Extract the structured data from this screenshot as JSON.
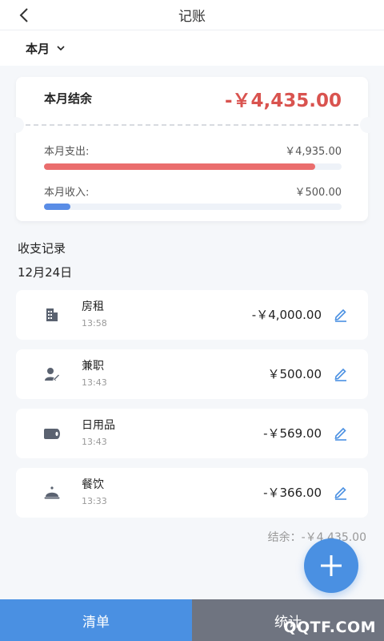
{
  "header": {
    "title": "记账",
    "back_icon": "chevron-left-icon"
  },
  "month_selector": {
    "label": "本月",
    "icon": "chevron-down-icon"
  },
  "summary": {
    "balance_label": "本月结余",
    "balance_value": "-￥4,435.00",
    "expense_label": "本月支出:",
    "expense_value": "￥4,935.00",
    "expense_fill_fraction": 0.91,
    "income_label": "本月收入:",
    "income_value": "￥500.00",
    "income_fill_fraction": 0.09,
    "colors": {
      "negative": "#d9534f",
      "expense_bar": "#ea6d6d",
      "income_bar": "#5a8de6"
    }
  },
  "records": {
    "section_title": "收支记录",
    "date": "12月24日",
    "items": [
      {
        "name": "房租",
        "time": "13:58",
        "amount": "-￥4,000.00",
        "icon": "building-icon"
      },
      {
        "name": "兼职",
        "time": "13:43",
        "amount": "￥500.00",
        "icon": "user-edit-icon"
      },
      {
        "name": "日用品",
        "time": "13:43",
        "amount": "-￥569.00",
        "icon": "tissue-roll-icon"
      },
      {
        "name": "餐饮",
        "time": "13:33",
        "amount": "-￥366.00",
        "icon": "dish-cloche-icon"
      }
    ],
    "balance_footer": "结余：-￥4,435.00"
  },
  "fab": {
    "icon": "plus-icon"
  },
  "tabs": [
    {
      "label": "清单",
      "active": true
    },
    {
      "label": "统计",
      "active": false
    }
  ],
  "watermark": "QQTF.COM",
  "accent_color": "#4a90e2"
}
